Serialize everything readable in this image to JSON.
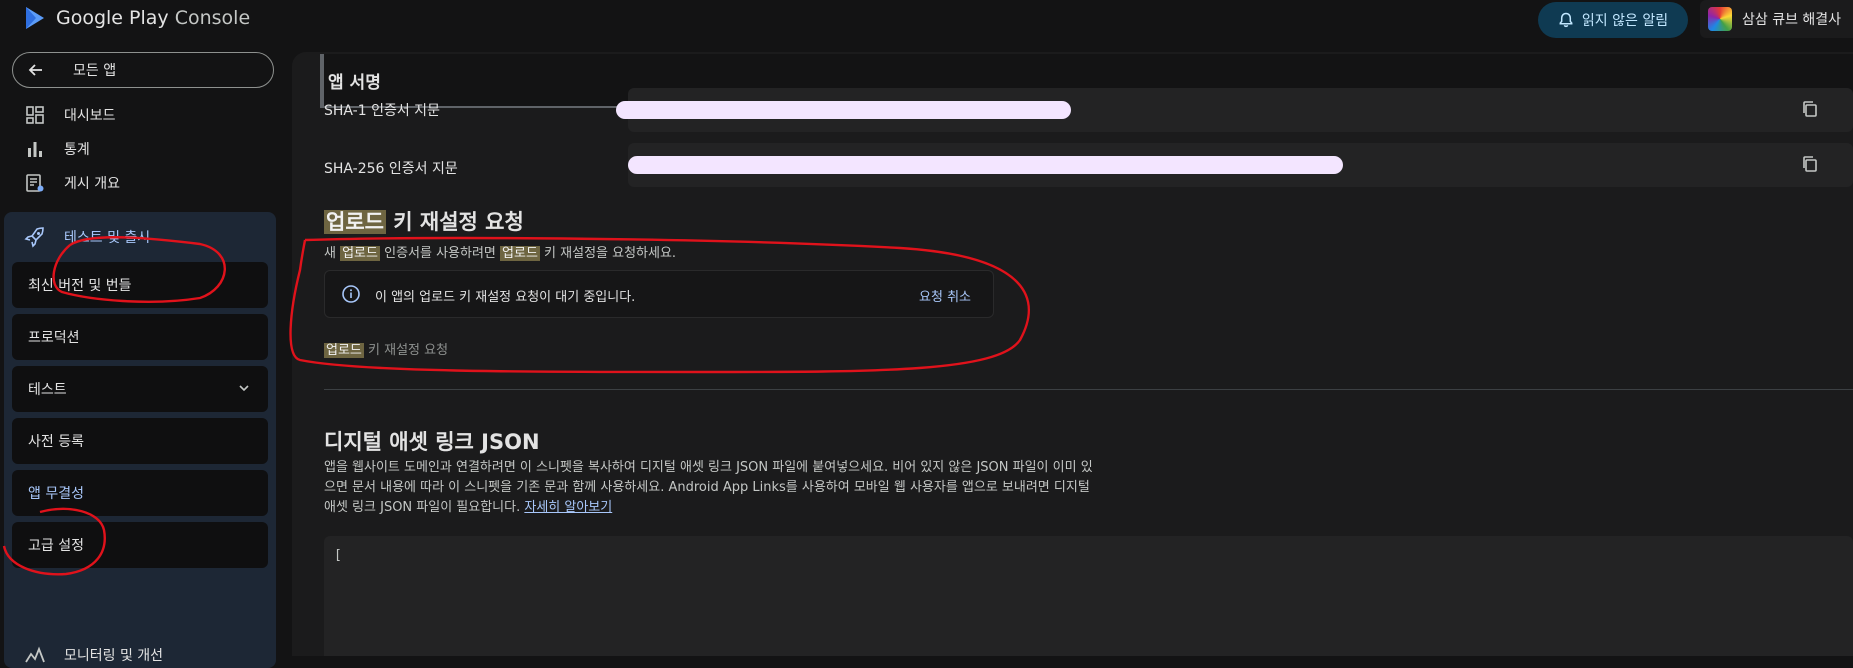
{
  "topbar": {
    "logo_main": "Google Play",
    "logo_sub": "Console",
    "notifications_label": "읽지 않은 알림",
    "account_name": "삼삼 큐브 해결사"
  },
  "sidebar": {
    "all_apps_label": "모든 앱",
    "items": [
      {
        "label": "대시보드",
        "icon": "dashboard-icon"
      },
      {
        "label": "통계",
        "icon": "bar-chart-icon"
      },
      {
        "label": "게시 개요",
        "icon": "publishing-overview-icon"
      }
    ],
    "release_group": {
      "label": "테스트 및 출시",
      "icon": "rocket-icon",
      "sub_items": [
        {
          "label": "최신 버전 및 번들"
        },
        {
          "label": "프로덕션"
        },
        {
          "label": "테스트",
          "expandable": true
        },
        {
          "label": "사전 등록"
        },
        {
          "label": "앱 무결성",
          "active": true
        },
        {
          "label": "고급 설정"
        }
      ]
    },
    "monitor_label": "모니터링 및 개선"
  },
  "main": {
    "signature_title": "앱 서명",
    "sha1_label": "SHA-1 인증서 지문",
    "sha256_label": "SHA-256 인증서 지문",
    "reset": {
      "title_hl": "업로드",
      "title_rest": " 키 재설정 요청",
      "desc_1": "새 ",
      "desc_hl1": "업로드",
      "desc_2": " 인증서를 사용하려면 ",
      "desc_hl2": "업로드",
      "desc_3": " 키 재설정을 요청하세요.",
      "pending_text": "이 앱의 업로드 키 재설정 요청이 대기 중입니다.",
      "cancel_label": "요청 취소",
      "link_hl": "업로드",
      "link_rest": " 키 재설정 요청"
    },
    "dal": {
      "title": "디지털 애셋 링크 JSON",
      "desc": "앱을 웹사이트 도메인과 연결하려면 이 스니펫을 복사하여 디지털 애셋 링크 JSON 파일에 붙여넣으세요. 비어 있지 않은 JSON 파일이 이미 있으면 문서 내용에 따라 이 스니펫을 기존 문과 함께 사용하세요. Android App Links를 사용하여 모바일 웹 사용자를 앱으로 보내려면 디지털 애셋 링크 JSON 파일이 필요합니다. ",
      "learn_more": "자세히 알아보기",
      "json_start": "["
    }
  },
  "colors": {
    "accent": "#a8c7fa",
    "annotation": "#e0121b",
    "highlight": "#6e6541"
  }
}
